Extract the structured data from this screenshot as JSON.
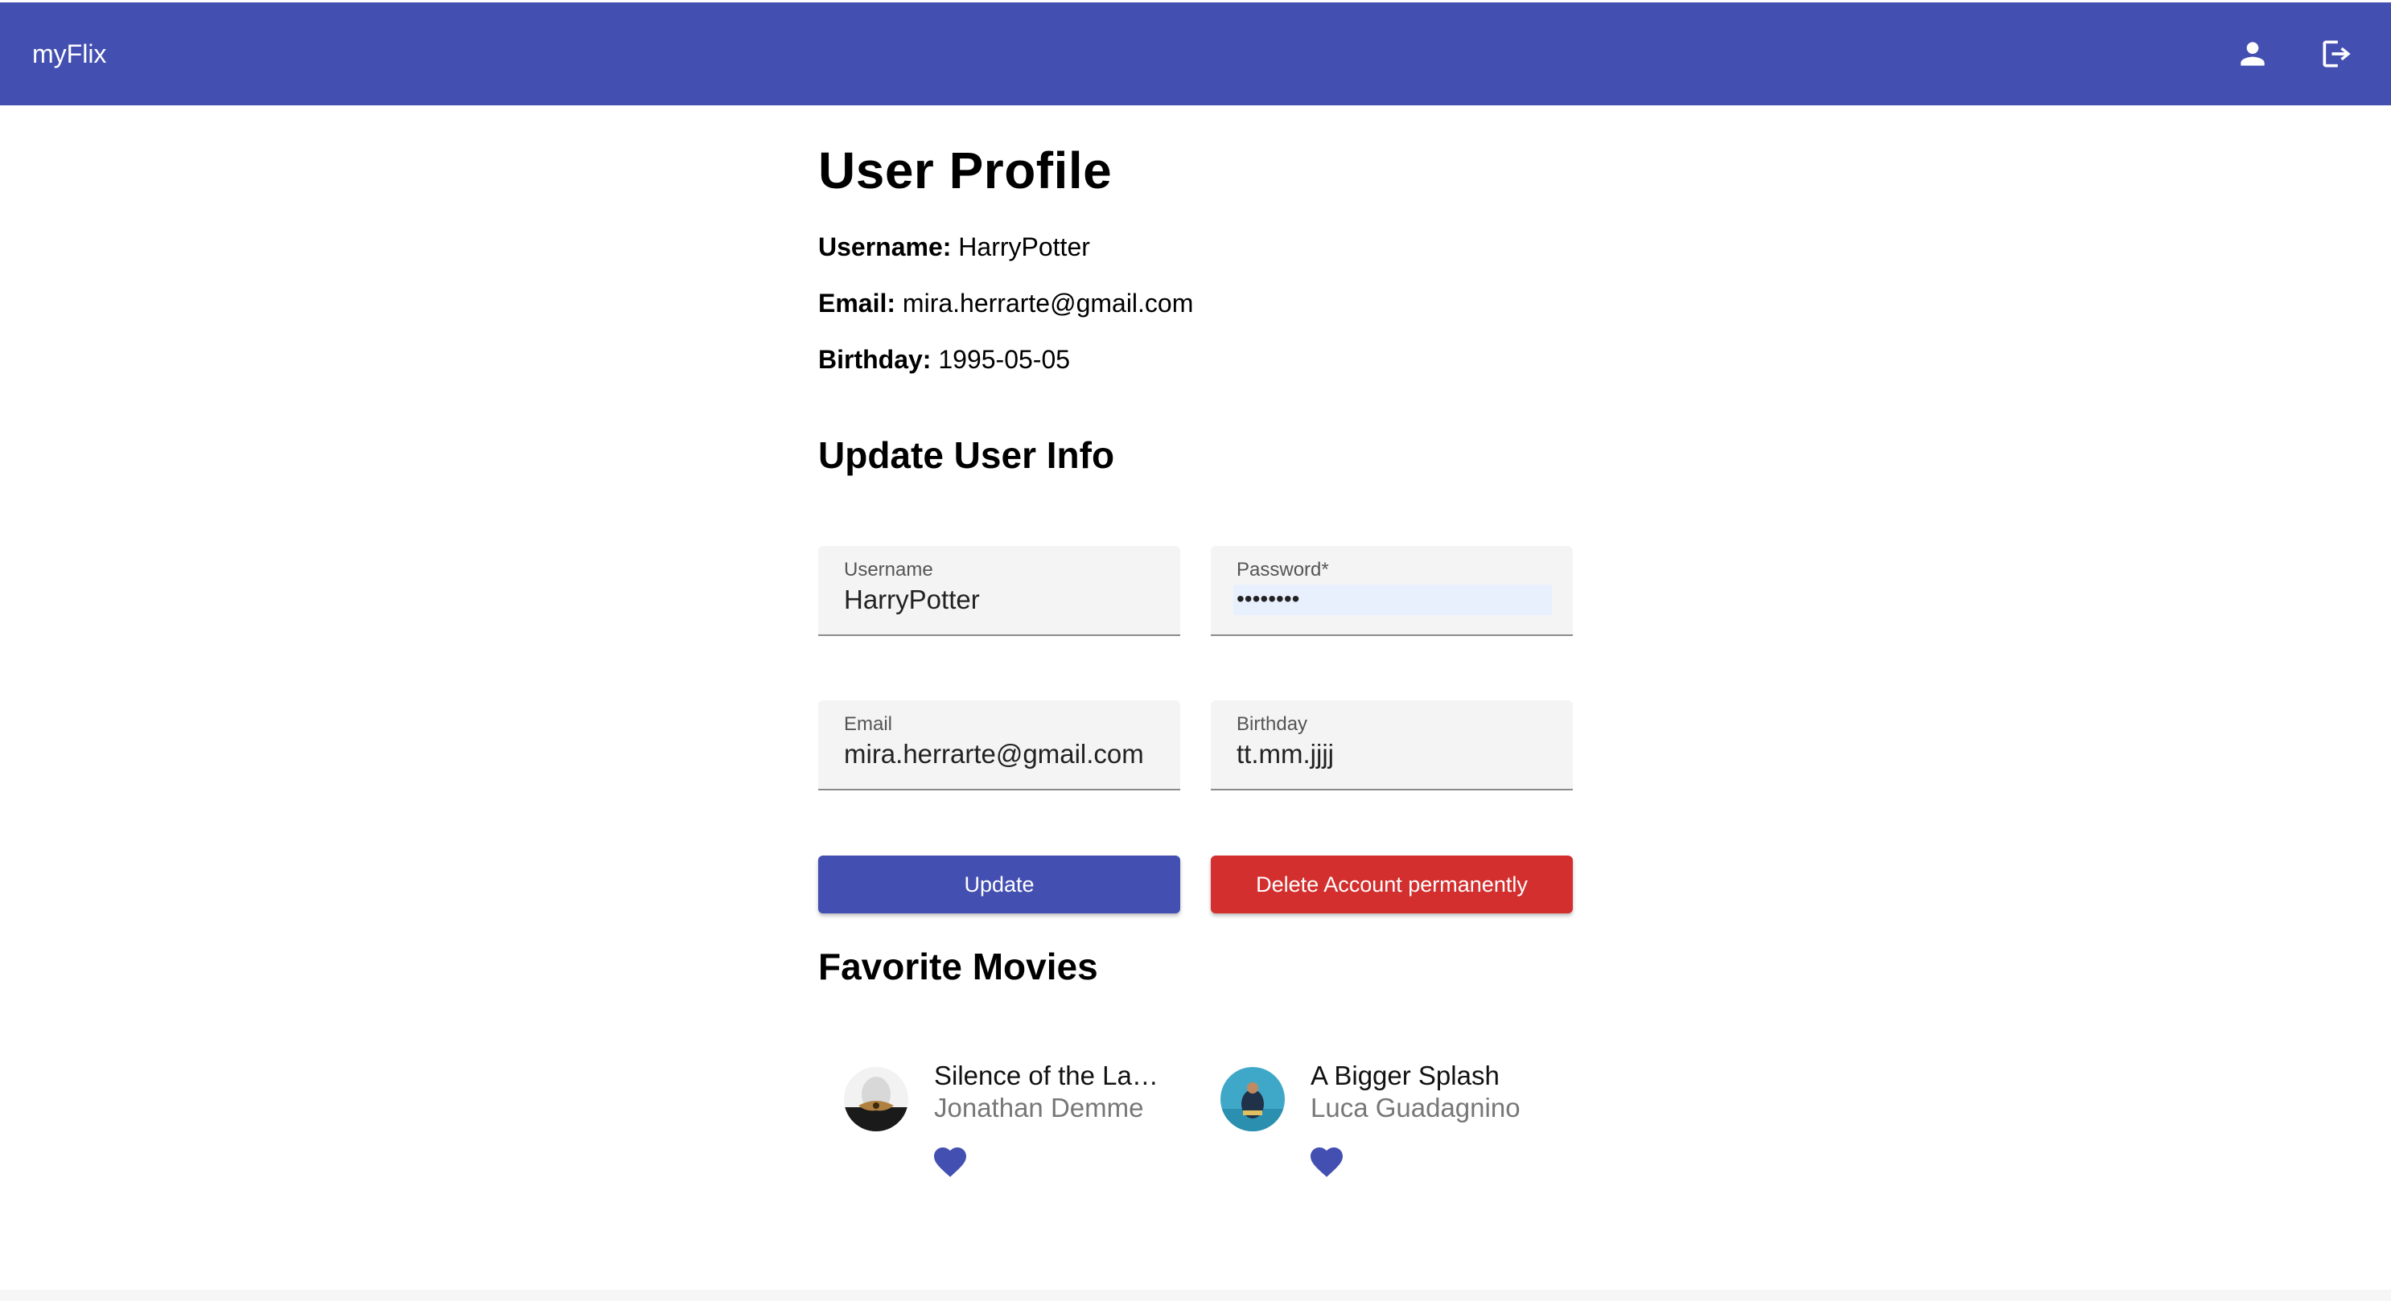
{
  "app": {
    "brand": "myFlix"
  },
  "colors": {
    "primary": "#4450b1",
    "danger": "#d32f2f",
    "heart": "#4450b1"
  },
  "header": {
    "icons": [
      "person-icon",
      "logout-icon"
    ]
  },
  "profile": {
    "title": "User Profile",
    "username_label": "Username:",
    "username": "HarryPotter",
    "email_label": "Email:",
    "email": "mira.herrarte@gmail.com",
    "birthday_label": "Birthday:",
    "birthday": "1995-05-05"
  },
  "update_form": {
    "title": "Update User Info",
    "username": {
      "label": "Username",
      "value": "HarryPotter"
    },
    "password": {
      "label": "Password*",
      "value": "••••••••"
    },
    "email": {
      "label": "Email",
      "value": "mira.herrarte@gmail.com"
    },
    "birthday": {
      "label": "Birthday",
      "value": "tt.mm.jjjj"
    },
    "update_label": "Update",
    "delete_label": "Delete Account permanently"
  },
  "favorites": {
    "title": "Favorite Movies",
    "movies": [
      {
        "title": "Silence of the Lambs",
        "director": "Jonathan Demme",
        "icon": "heart-icon"
      },
      {
        "title": "A Bigger Splash",
        "director": "Luca Guadagnino",
        "icon": "heart-icon"
      }
    ]
  }
}
